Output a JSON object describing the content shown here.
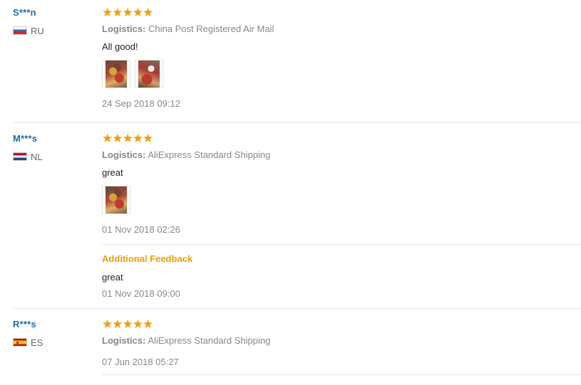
{
  "reviews": [
    {
      "user": "S***n",
      "country": "RU",
      "stars": "★★★★★",
      "logistics_label": "Logistics:",
      "logistics_value": "China Post Registered Air Mail",
      "feedback": "All good!",
      "date": "24 Sep 2018 09:12"
    },
    {
      "user": "M***s",
      "country": "NL",
      "stars": "★★★★★",
      "logistics_label": "Logistics:",
      "logistics_value": "AliExpress Standard Shipping",
      "feedback": "great",
      "date": "01 Nov 2018 02:26",
      "additional_title": "Additional Feedback",
      "additional_text": "great",
      "additional_date": "01 Nov 2018 09:00"
    },
    {
      "user": "R***s",
      "country": "ES",
      "stars": "★★★★★",
      "logistics_label": "Logistics:",
      "logistics_value": "AliExpress Standard Shipping",
      "date": "07 Jun 2018 05:27"
    }
  ],
  "rating": {
    "value": 5,
    "max": 5
  },
  "colors": {
    "user": "#1a6bb3",
    "star": "#f59b00",
    "additional": "#f0a000",
    "muted": "#888888"
  }
}
